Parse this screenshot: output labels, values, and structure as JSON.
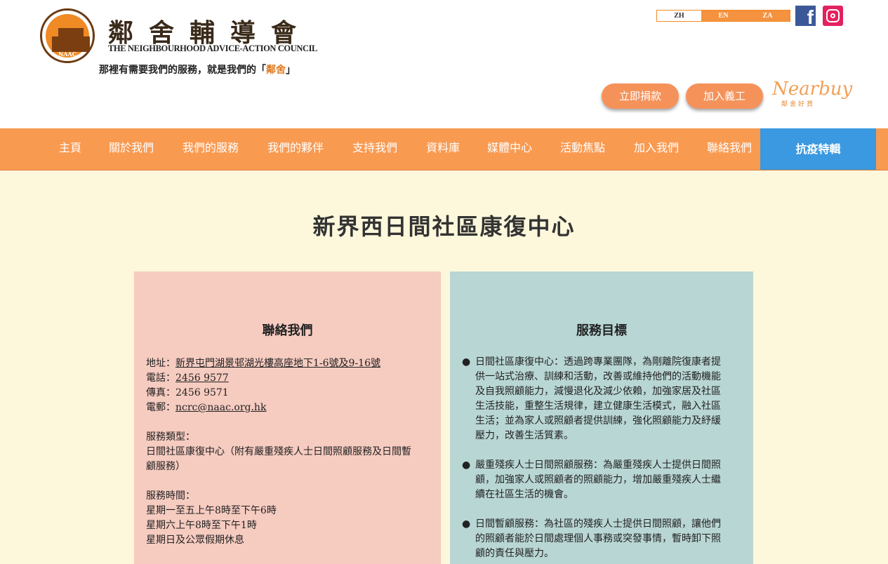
{
  "header": {
    "logo_abbr": "NAAC",
    "org_name_cn": "鄰舍輔導會",
    "org_name_en": "THE NEIGHBOURHOOD ADVICE-ACTION COUNCIL",
    "slogan_pre": "那裡有需要我們的服務，就是我們的「",
    "slogan_hl": "鄰舍",
    "slogan_post": "」",
    "languages": [
      "ZH",
      "EN",
      "ZA"
    ],
    "donate_label": "立即捐款",
    "volunteer_label": "加入義工",
    "nearby_word": "Nearbuy",
    "nearby_cn": "鄰舍好貨",
    "facebook_glyph": "f"
  },
  "nav": {
    "items": [
      "主頁",
      "關於我們",
      "我們的服務",
      "我們的夥伴",
      "支持我們",
      "資料庫",
      "媒體中心",
      "活動焦點",
      "加入我們",
      "聯絡我們"
    ],
    "special": "抗疫特輯"
  },
  "page": {
    "title": "新界西日間社區康復中心"
  },
  "contact": {
    "heading": "聯絡我們",
    "address_label": "地址：",
    "address": "新界屯門湖景邨湖光樓高座地下1-6號及9-16號",
    "phone_label": "電話：",
    "phone": "2456 9577",
    "fax_label": "傳真：",
    "fax": "2456 9571",
    "email_label": "電郵：",
    "email": "ncrc@naac.org.hk",
    "service_type_label": "服務類型：",
    "service_type_line1": "日間社區康復中心（附有嚴重殘疾人士日間照顧服務及日間暫",
    "service_type_line2": "顧服務）",
    "hours_label": "服務時間：",
    "hours": [
      "星期一至五上午8時至下午6時",
      "星期六上午8時至下午1時",
      "星期日及公眾假期休息"
    ]
  },
  "service": {
    "heading": "服務目標",
    "bullets": [
      [
        "日間社區康復中心：透過跨專業團隊，為剛離院復康者提",
        "供一站式治療、訓練和活動，改善或維持他們的活動機能",
        "及自我照顧能力，減慢退化及減少依賴，加強家居及社區",
        "生活技能，重整生活規律，建立健康生活模式，融入社區",
        "生活；並為家人或照顧者提供訓練，強化照顧能力及紓緩",
        "壓力，改善生活質素。"
      ],
      [
        "嚴重殘疾人士日間照顧服務：為嚴重殘疾人士提供日間照",
        "顧，加強家人或照顧者的照顧能力，增加嚴重殘疾人士繼",
        "續在社區生活的機會。"
      ],
      [
        "日間暫顧服務：為社區的殘疾人士提供日間照顧，讓他們",
        "的照顧者能於日間處理個人事務或突發事情，暫時卸下照",
        "顧的責任與壓力。"
      ]
    ]
  },
  "colors": {
    "nav_bg": "#f99a51",
    "nav_special_bg": "#3a99e0",
    "page_bg": "#fdf8dc",
    "contact_card_bg": "#f6cbc0",
    "service_card_bg": "#b8d6d4"
  }
}
